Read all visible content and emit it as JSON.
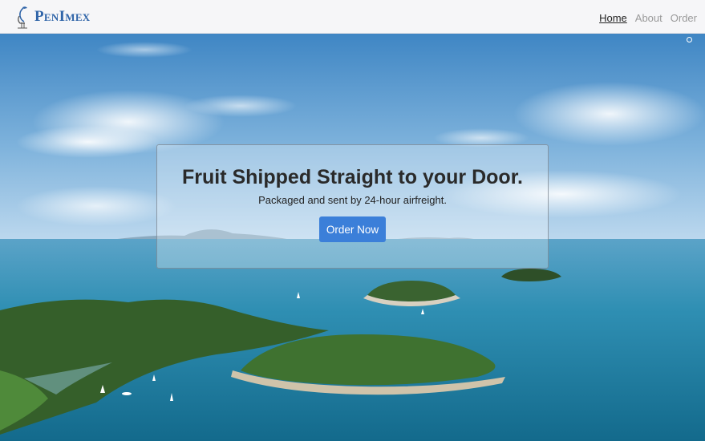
{
  "brand": {
    "name": "PenImex",
    "logo_icon": "heron-logo-icon"
  },
  "nav": {
    "items": [
      {
        "label": "Home",
        "active": true
      },
      {
        "label": "About",
        "active": false
      },
      {
        "label": "Order",
        "active": false
      }
    ]
  },
  "hero": {
    "title": "Fruit Shipped Straight to your Door.",
    "subtitle": "Packaged and sent by 24-hour airfreight.",
    "cta_label": "Order Now"
  },
  "colors": {
    "brand": "#2f64a8",
    "button": "#3b7fd9",
    "nav_active": "#222222",
    "nav_inactive": "#9a9a9a"
  }
}
